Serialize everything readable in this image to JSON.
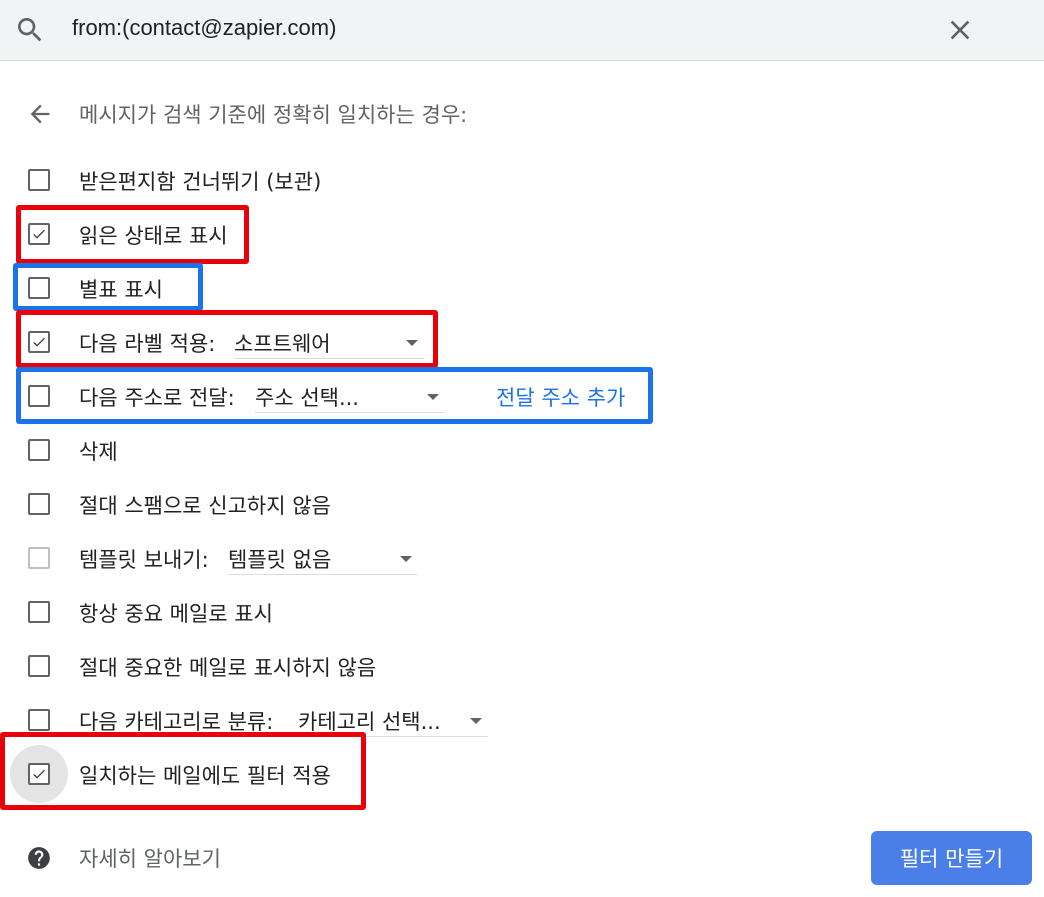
{
  "search": {
    "query": "from:(contact@zapier.com)"
  },
  "header": {
    "text": "메시지가 검색 기준에 정확히 일치하는 경우:"
  },
  "options": {
    "skip_inbox": {
      "label": "받은편지함 건너뛰기 (보관)",
      "checked": false
    },
    "mark_read": {
      "label": "읽은 상태로 표시",
      "checked": true
    },
    "star": {
      "label": "별표 표시",
      "checked": false
    },
    "apply_label": {
      "label": "다음 라벨 적용:",
      "checked": true,
      "selected": "소프트웨어"
    },
    "forward": {
      "label": "다음 주소로 전달:",
      "checked": false,
      "selected": "주소 선택...",
      "link": "전달 주소 추가"
    },
    "delete": {
      "label": "삭제",
      "checked": false
    },
    "never_spam": {
      "label": "절대 스팸으로 신고하지 않음",
      "checked": false
    },
    "send_template": {
      "label": "템플릿 보내기:",
      "checked": false,
      "disabled": true,
      "selected": "템플릿 없음"
    },
    "always_important": {
      "label": "항상 중요 메일로 표시",
      "checked": false
    },
    "never_important": {
      "label": "절대 중요한 메일로 표시하지 않음",
      "checked": false
    },
    "categorize": {
      "label": "다음 카테고리로 분류:",
      "checked": false,
      "selected": "카테고리 선택..."
    },
    "also_apply": {
      "label": "일치하는 메일에도 필터 적용",
      "checked": true
    }
  },
  "footer": {
    "learn_more": "자세히 알아보기",
    "create_button": "필터 만들기"
  },
  "colors": {
    "highlight_red": "#e8000b",
    "highlight_blue": "#1a73e8",
    "button": "#4a7fe8",
    "link": "#1a73e8"
  }
}
